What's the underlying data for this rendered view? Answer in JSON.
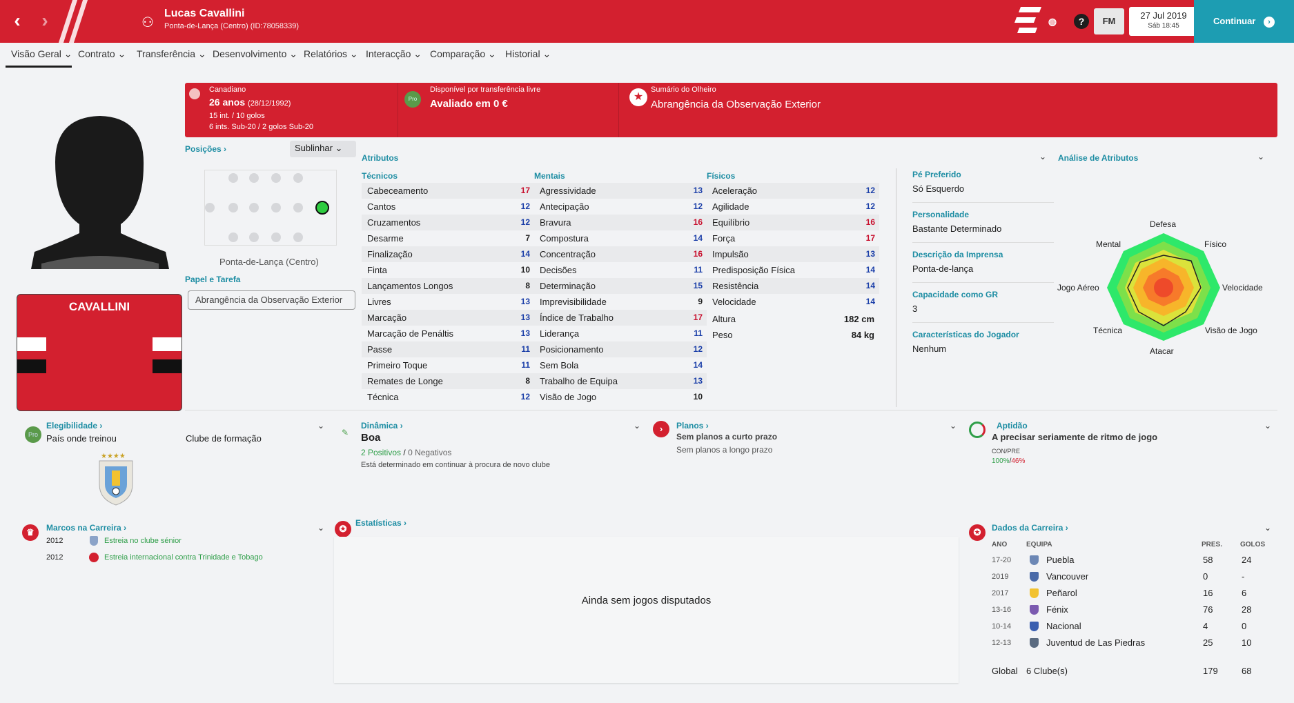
{
  "header": {
    "player_name": "Lucas Cavallini",
    "subtitle": "Ponta-de-Lança (Centro) (ID:78058339)",
    "date": "27 Jul 2019",
    "time": "Sáb 18:45",
    "fm_label": "FM",
    "continue_label": "Continuar",
    "help_label": "?"
  },
  "tabs": [
    "Visão Geral",
    "Contrato",
    "Transferência",
    "Desenvolvimento",
    "Relatórios",
    "Interacção",
    "Comparação",
    "Historial"
  ],
  "summary": {
    "nationality": "Canadiano",
    "age": "26 anos",
    "dob": "(28/12/1992)",
    "caps": "15 int. / 10 golos",
    "u20": "6 ints. Sub-20 / 2 golos Sub-20",
    "transfer_label": "Disponível por transferência livre",
    "value": "Avaliado em 0 €",
    "scout_label": "Sumário do Olheiro",
    "scout_value": "Abrangência da Observação Exterior"
  },
  "positions": {
    "title": "Posições",
    "highlight": "Sublinhar",
    "position_name": "Ponta-de-Lança (Centro)",
    "role_title": "Papel e Tarefa",
    "role_value": "Abrangência da Observação Exterior"
  },
  "shirt": {
    "name": "CAVALLINI"
  },
  "attributes": {
    "title": "Atributos",
    "analysis_title": "Análise de Atributos",
    "technical_title": "Técnicos",
    "mental_title": "Mentais",
    "physical_title": "Físicos",
    "technical": [
      {
        "name": "Cabeceamento",
        "value": "17",
        "color": "red"
      },
      {
        "name": "Cantos",
        "value": "12",
        "color": "blue"
      },
      {
        "name": "Cruzamentos",
        "value": "12",
        "color": "blue"
      },
      {
        "name": "Desarme",
        "value": "7",
        "color": "black"
      },
      {
        "name": "Finalização",
        "value": "14",
        "color": "blue"
      },
      {
        "name": "Finta",
        "value": "10",
        "color": "black"
      },
      {
        "name": "Lançamentos Longos",
        "value": "8",
        "color": "black"
      },
      {
        "name": "Livres",
        "value": "13",
        "color": "blue"
      },
      {
        "name": "Marcação",
        "value": "13",
        "color": "blue"
      },
      {
        "name": "Marcação de Penáltis",
        "value": "13",
        "color": "blue"
      },
      {
        "name": "Passe",
        "value": "11",
        "color": "blue"
      },
      {
        "name": "Primeiro Toque",
        "value": "11",
        "color": "blue"
      },
      {
        "name": "Remates de Longe",
        "value": "8",
        "color": "black"
      },
      {
        "name": "Técnica",
        "value": "12",
        "color": "blue"
      }
    ],
    "mental": [
      {
        "name": "Agressividade",
        "value": "13",
        "color": "blue"
      },
      {
        "name": "Antecipação",
        "value": "12",
        "color": "blue"
      },
      {
        "name": "Bravura",
        "value": "16",
        "color": "red"
      },
      {
        "name": "Compostura",
        "value": "14",
        "color": "blue"
      },
      {
        "name": "Concentração",
        "value": "16",
        "color": "red"
      },
      {
        "name": "Decisões",
        "value": "11",
        "color": "blue"
      },
      {
        "name": "Determinação",
        "value": "15",
        "color": "blue"
      },
      {
        "name": "Imprevisibilidade",
        "value": "9",
        "color": "black"
      },
      {
        "name": "Índice de Trabalho",
        "value": "17",
        "color": "red"
      },
      {
        "name": "Liderança",
        "value": "11",
        "color": "blue"
      },
      {
        "name": "Posicionamento",
        "value": "12",
        "color": "blue"
      },
      {
        "name": "Sem Bola",
        "value": "14",
        "color": "blue"
      },
      {
        "name": "Trabalho de Equipa",
        "value": "13",
        "color": "blue"
      },
      {
        "name": "Visão de Jogo",
        "value": "10",
        "color": "black"
      }
    ],
    "physical": [
      {
        "name": "Aceleração",
        "value": "12",
        "color": "blue"
      },
      {
        "name": "Agilidade",
        "value": "12",
        "color": "blue"
      },
      {
        "name": "Equilíbrio",
        "value": "16",
        "color": "red"
      },
      {
        "name": "Força",
        "value": "17",
        "color": "red"
      },
      {
        "name": "Impulsão",
        "value": "13",
        "color": "blue"
      },
      {
        "name": "Predisposição Física",
        "value": "14",
        "color": "blue"
      },
      {
        "name": "Resistência",
        "value": "14",
        "color": "blue"
      },
      {
        "name": "Velocidade",
        "value": "14",
        "color": "blue"
      }
    ],
    "height_label": "Altura",
    "height": "182 cm",
    "weight_label": "Peso",
    "weight": "84 kg"
  },
  "info": [
    {
      "label": "Pé Preferido",
      "value": "Só Esquerdo"
    },
    {
      "label": "Personalidade",
      "value": "Bastante Determinado"
    },
    {
      "label": "Descrição da Imprensa",
      "value": "Ponta-de-lança"
    },
    {
      "label": "Capacidade como GR",
      "value": "3"
    },
    {
      "label": "Características do Jogador",
      "value": "Nenhum"
    }
  ],
  "radar": [
    "Defesa",
    "Físico",
    "Velocidade",
    "Visão de Jogo",
    "Atacar",
    "Técnica",
    "Jogo Aéreo",
    "Mental"
  ],
  "eligibility": {
    "title": "Elegibilidade",
    "trained_label": "País onde treinou",
    "club_label": "Clube de formação"
  },
  "dynamics": {
    "title": "Dinâmica",
    "value": "Boa",
    "positives": "2 Positivos",
    "slash": "/",
    "negatives": "0 Negativos",
    "note": "Está determinado em continuar à procura de novo clube"
  },
  "plans": {
    "title": "Planos",
    "short": "Sem planos a curto prazo",
    "long": "Sem planos a longo prazo"
  },
  "fitness": {
    "title": "Aptidão",
    "value": "A precisar seriamente de ritmo de jogo",
    "con_label": "CON/PRE",
    "con": "100%",
    "pre": "46%",
    "slash": "/"
  },
  "milestones": {
    "title": "Marcos na Carreira",
    "items": [
      {
        "year": "2012",
        "text": "Estreia no clube sénior"
      },
      {
        "year": "2012",
        "text": "Estreia internacional contra Trinidade e Tobago"
      }
    ]
  },
  "stats": {
    "title": "Estatísticas",
    "empty": "Ainda sem jogos disputados"
  },
  "career": {
    "title": "Dados da Carreira",
    "headers": {
      "year": "ANO",
      "team": "EQUIPA",
      "apps": "PRES.",
      "goals": "GOLOS"
    },
    "rows": [
      {
        "year": "17-20",
        "team": "Puebla",
        "apps": "58",
        "goals": "24"
      },
      {
        "year": "2019",
        "team": "Vancouver",
        "apps": "0",
        "goals": "-"
      },
      {
        "year": "2017",
        "team": "Peñarol",
        "apps": "16",
        "goals": "6"
      },
      {
        "year": "13-16",
        "team": "Fénix",
        "apps": "76",
        "goals": "28"
      },
      {
        "year": "10-14",
        "team": "Nacional",
        "apps": "4",
        "goals": "0"
      },
      {
        "year": "12-13",
        "team": "Juventud de Las Piedras",
        "apps": "25",
        "goals": "10"
      }
    ],
    "total_label": "Global",
    "total_clubs": "6 Clube(s)",
    "total_apps": "179",
    "total_goals": "68"
  },
  "colors": {
    "brand_red": "#d3202f",
    "accent_teal": "#1d8da3",
    "continue_bg": "#1d9db2",
    "attr_blue": "#1a3ea8",
    "attr_red": "#c8102e"
  }
}
